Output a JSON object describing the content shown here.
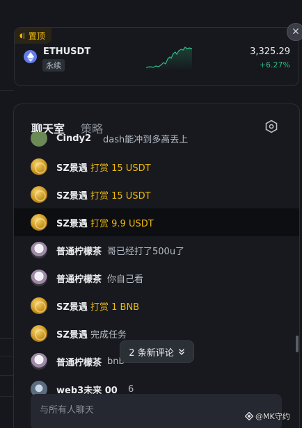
{
  "pinned": {
    "tag": "置顶",
    "symbol": "ETHUSDT",
    "contract_type": "永续",
    "price": "3,325.29",
    "change": "+6.27%",
    "close_icon": "close-icon"
  },
  "chat": {
    "tabs": [
      "聊天室",
      "策略"
    ],
    "settings_icon": "hexagon-settings-icon",
    "messages": [
      {
        "user": "Cindy2",
        "text": "dash能冲到多高丢上",
        "type": "text",
        "avatar": "cindy"
      },
      {
        "user": "SZ景遇",
        "text": "打赏 15 USDT",
        "type": "tip",
        "avatar": "gold"
      },
      {
        "user": "SZ景遇",
        "text": "打赏 15 USDT",
        "type": "tip",
        "avatar": "gold"
      },
      {
        "user": "SZ景遇",
        "text": "打赏 9.9 USDT",
        "type": "tip",
        "avatar": "gold"
      },
      {
        "user": "普通柠檬茶",
        "text": "哥已经打了500u了",
        "type": "text",
        "avatar": "lemon"
      },
      {
        "user": "普通柠檬茶",
        "text": "你自己看",
        "type": "text",
        "avatar": "lemon"
      },
      {
        "user": "SZ景遇",
        "text": "打赏 1 BNB",
        "type": "tip",
        "avatar": "gold"
      },
      {
        "user": "SZ景遇",
        "text": "完成任务",
        "type": "text",
        "avatar": "gold"
      },
      {
        "user": "普通柠檬茶",
        "text": "bnb",
        "type": "text",
        "avatar": "lemon"
      },
      {
        "user": "web3未来 00",
        "text": "6",
        "type": "text",
        "avatar": "web3"
      }
    ],
    "new_comments": "2 条新评论",
    "input_placeholder": "与所有人聊天"
  },
  "watermark": "@MK守约",
  "colors": {
    "accent": "#f0b90b",
    "up": "#2ebd85",
    "background": "#15171c",
    "panel": "#17191e"
  }
}
